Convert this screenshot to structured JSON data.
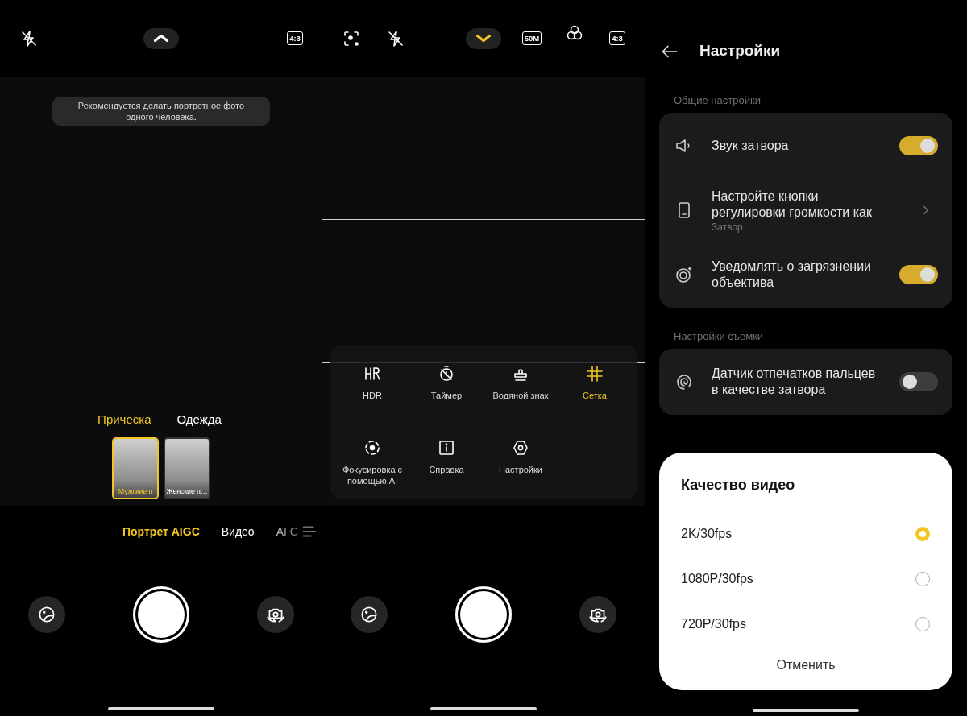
{
  "portrait_screen": {
    "more_toggle": {
      "expanded": false
    },
    "aspect_ratio": "4:3",
    "hint": "Рекомендуется делать портретное фото одного человека.",
    "style_tabs": [
      {
        "label": "Прическа",
        "selected": true
      },
      {
        "label": "Одежда",
        "selected": false
      }
    ],
    "style_options": [
      {
        "label": "Мужские п",
        "selected": true
      },
      {
        "label": "Женские п…",
        "selected": false
      }
    ],
    "modes": [
      {
        "label": "Портрет AIGC",
        "selected": true
      },
      {
        "label": "Видео",
        "selected": false
      },
      {
        "label": "AI C",
        "selected": false
      }
    ]
  },
  "tools_screen": {
    "more_toggle": {
      "expanded": true
    },
    "resolution": "50M",
    "aspect_ratio": "4:3",
    "tools": [
      {
        "kind": "hdr",
        "label": "HDR",
        "selected": false
      },
      {
        "kind": "timer",
        "label": "Таймер",
        "selected": false
      },
      {
        "kind": "watermark",
        "label": "Водяной знак",
        "selected": false
      },
      {
        "kind": "grid",
        "label": "Сетка",
        "selected": true
      },
      {
        "kind": "ai-focus",
        "label": "Фокусировка с помощью AI",
        "selected": false
      },
      {
        "kind": "help",
        "label": "Справка",
        "selected": false
      },
      {
        "kind": "settings",
        "label": "Настройки",
        "selected": false
      }
    ]
  },
  "settings_screen": {
    "title": "Настройки",
    "sections": [
      {
        "title": "Общие настройки",
        "rows": [
          {
            "kind": "toggle",
            "label": "Звук затвора",
            "on": true
          },
          {
            "kind": "link",
            "label": "Настройте кнопки регулировки громкости как",
            "value": "Затвор"
          },
          {
            "kind": "toggle",
            "label": "Уведомлять о загрязнении объектива",
            "on": true
          }
        ]
      },
      {
        "title": "Настройки съемки",
        "rows": [
          {
            "kind": "toggle",
            "label": "Датчик отпечатков пальцев в качестве затвора",
            "on": false
          }
        ]
      }
    ],
    "dialog": {
      "title": "Качество видео",
      "options": [
        {
          "label": "2K/30fps",
          "selected": true
        },
        {
          "label": "1080P/30fps",
          "selected": false
        },
        {
          "label": "720P/30fps",
          "selected": false
        }
      ],
      "cancel": "Отменить"
    }
  }
}
